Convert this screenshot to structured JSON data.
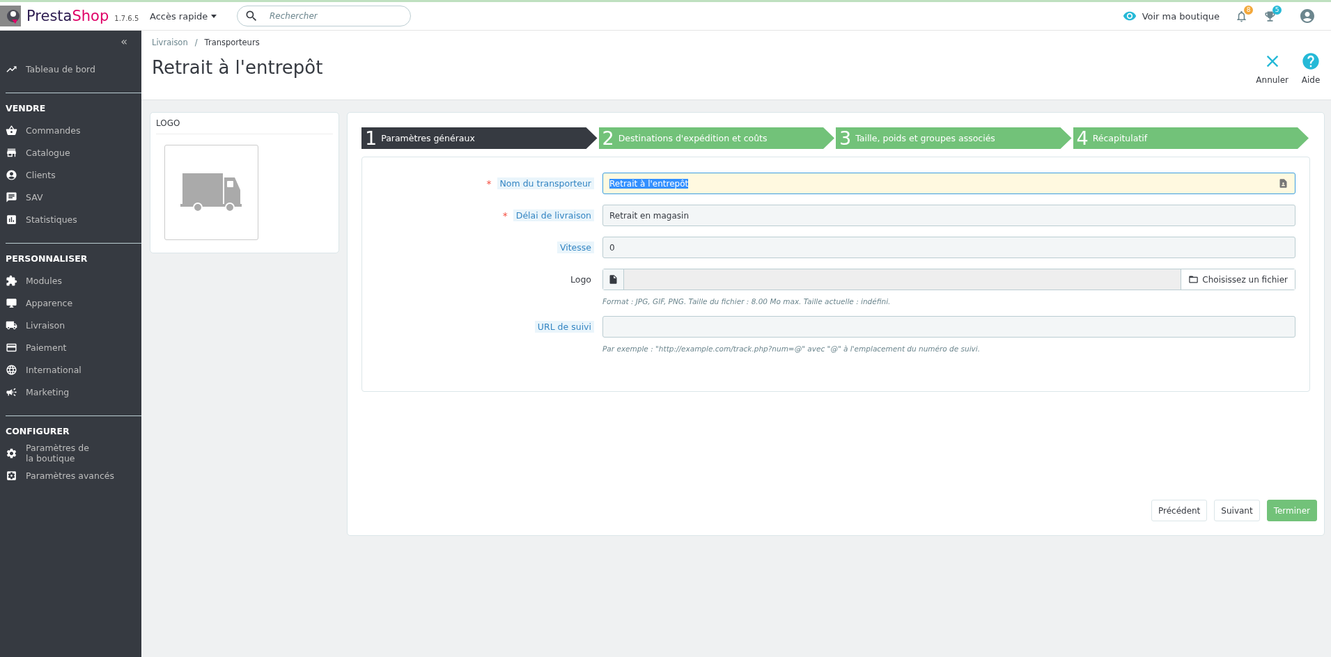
{
  "header": {
    "brand": {
      "part_1": "Presta",
      "part_2": "Shop"
    },
    "version": "1.7.6.5",
    "quick_access": "Accès rapide",
    "search": {
      "placeholder": "Rechercher"
    },
    "view_shop": "Voir ma boutique",
    "badges": [
      {
        "count": "8",
        "color": "#f3a83b"
      },
      {
        "count": "5",
        "color": "#25b9d7"
      }
    ]
  },
  "sidebar": {
    "collapse": "«",
    "top_item": "Tableau de bord",
    "sections": [
      {
        "title": "VENDRE",
        "items": [
          "Commandes",
          "Catalogue",
          "Clients",
          "SAV",
          "Statistiques"
        ]
      },
      {
        "title": "PERSONNALISER",
        "items": [
          "Modules",
          "Apparence",
          "Livraison",
          "Paiement",
          "International",
          "Marketing"
        ]
      },
      {
        "title": "CONFIGURER",
        "items": [
          "Paramètres de la boutique",
          "Paramètres avancés"
        ]
      }
    ]
  },
  "required_mark": "*",
  "page": {
    "breadcrumb_separator": "/",
    "breadcrumb": [
      "Livraison",
      "Transporteurs"
    ],
    "title": "Retrait à l'entrepôt",
    "actions": [
      "Annuler",
      "Aide"
    ]
  },
  "logo_panel": {
    "title": "LOGO"
  },
  "steps": [
    {
      "number": "1",
      "label": "Paramètres généraux",
      "selected": true
    },
    {
      "number": "2",
      "label": "Destinations d'expédition et coûts",
      "selected": false
    },
    {
      "number": "3",
      "label": "Taille, poids et groupes associés",
      "selected": false
    },
    {
      "number": "4",
      "label": "Récapitulatif",
      "selected": false
    }
  ],
  "fields": [
    {
      "kind": "text",
      "label": "Nom du transporteur",
      "required": true,
      "translatable": true,
      "focused": true,
      "value": "Retrait à l'entrepôt"
    },
    {
      "kind": "text",
      "label": "Délai de livraison",
      "required": true,
      "translatable": true,
      "focused": false,
      "value": "Retrait en magasin"
    },
    {
      "kind": "text",
      "label": "Vitesse",
      "required": false,
      "translatable": true,
      "focused": false,
      "value": "0"
    },
    {
      "kind": "file",
      "label": "Logo",
      "required": false,
      "translatable": false,
      "button": "Choisissez un fichier",
      "hint": "Format : JPG, GIF, PNG. Taille du fichier : 8.00 Mo max. Taille actuelle : indéfini."
    },
    {
      "kind": "text",
      "label": "URL de suivi",
      "required": false,
      "translatable": true,
      "focused": false,
      "hint": "Par exemple : \"http://example.com/track.php?num=@\" avec \"@\" à l'emplacement du numéro de suivi."
    }
  ],
  "buttons": [
    {
      "label": "Précédent",
      "kind": "default"
    },
    {
      "label": "Suivant",
      "kind": "default"
    },
    {
      "label": "Terminer",
      "kind": "primary"
    }
  ]
}
